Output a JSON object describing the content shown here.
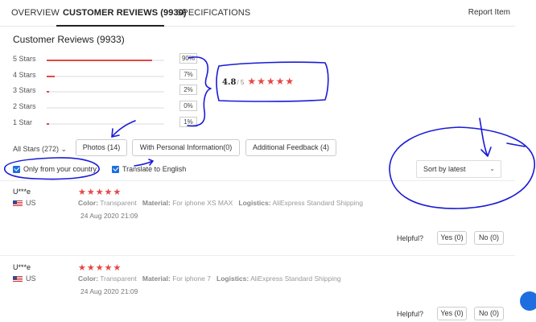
{
  "tabs": [
    {
      "label": "OVERVIEW"
    },
    {
      "label": "CUSTOMER REVIEWS (9930)"
    },
    {
      "label": "SPECIFICATIONS"
    }
  ],
  "report_label": "Report Item",
  "reviews_title": "Customer Reviews (9933)",
  "rating_rows": [
    {
      "label": "5 Stars",
      "percent": "90%",
      "fraction": 0.9
    },
    {
      "label": "4 Stars",
      "percent": "7%",
      "fraction": 0.07
    },
    {
      "label": "3 Stars",
      "percent": "2%",
      "fraction": 0.02
    },
    {
      "label": "2 Stars",
      "percent": "0%",
      "fraction": 0.0
    },
    {
      "label": "1 Star",
      "percent": "1%",
      "fraction": 0.01
    }
  ],
  "score": {
    "value": "4.8",
    "max": "/ 5",
    "stars": "★★★★★"
  },
  "filters": {
    "all_stars": "All Stars (272)",
    "photos": "Photos (14)",
    "personal_info": "With Personal Information(0)",
    "additional_feedback": "Additional Feedback (4)"
  },
  "checkboxes": {
    "only_country": "Only from your country",
    "translate": "Translate to English"
  },
  "sort": {
    "selected": "Sort by latest"
  },
  "reviews": [
    {
      "name": "U***e",
      "country": "US",
      "stars": "★★★★★",
      "color_label": "Color:",
      "color_value": "Transparent",
      "material_label": "Material:",
      "material_value": "For iphone XS MAX",
      "logistics_label": "Logistics:",
      "logistics_value": "AliExpress Standard Shipping",
      "date": "24 Aug 2020 21:09",
      "helpful": "Helpful?",
      "yes": "Yes (0)",
      "no": "No (0)"
    },
    {
      "name": "U***e",
      "country": "US",
      "stars": "★★★★★",
      "color_label": "Color:",
      "color_value": "Transparent",
      "material_label": "Material:",
      "material_value": "For iphone 7",
      "logistics_label": "Logistics:",
      "logistics_value": "AliExpress Standard Shipping",
      "date": "24 Aug 2020 21:09",
      "helpful": "Helpful?",
      "yes": "Yes (0)",
      "no": "No (0)"
    }
  ],
  "colors": {
    "accent_red": "#e64545",
    "checkbox_blue": "#1e6ee0",
    "annotation_blue": "#1a1ad8"
  }
}
